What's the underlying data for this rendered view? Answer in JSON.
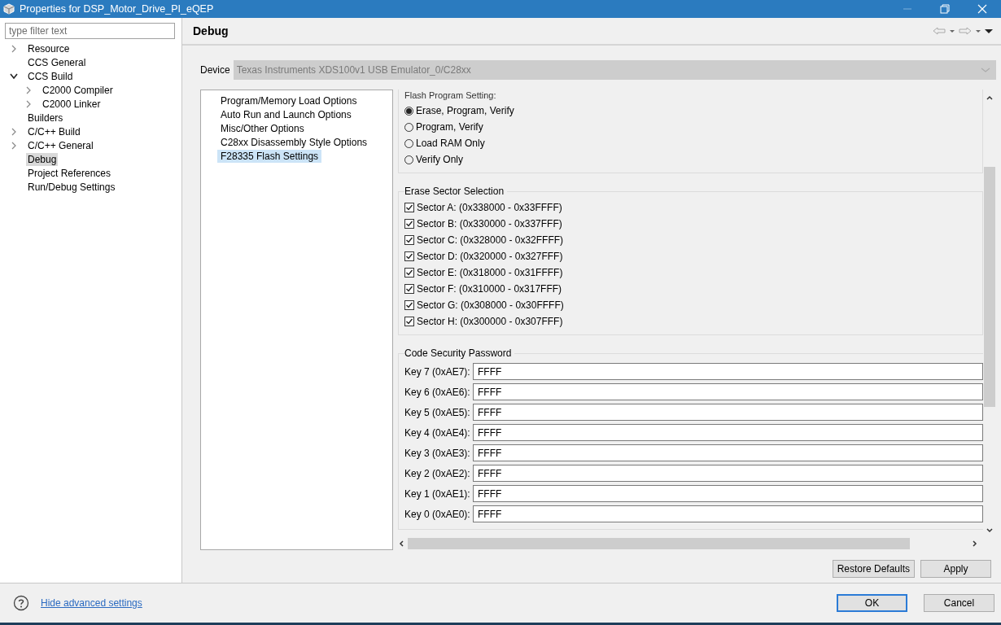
{
  "window": {
    "title": "Properties for DSP_Motor_Drive_PI_eQEP"
  },
  "filter": {
    "placeholder": "type filter text"
  },
  "tree": [
    {
      "label": "Resource",
      "expandable": true,
      "expanded": false,
      "selected": false
    },
    {
      "label": "CCS General",
      "expandable": false,
      "selected": false
    },
    {
      "label": "CCS Build",
      "expandable": true,
      "expanded": true,
      "selected": false,
      "children": [
        {
          "label": "C2000 Compiler",
          "expandable": true,
          "expanded": false,
          "selected": false
        },
        {
          "label": "C2000 Linker",
          "expandable": true,
          "expanded": false,
          "selected": false
        }
      ]
    },
    {
      "label": "Builders",
      "expandable": false,
      "selected": false
    },
    {
      "label": "C/C++ Build",
      "expandable": true,
      "expanded": false,
      "selected": false
    },
    {
      "label": "C/C++ General",
      "expandable": true,
      "expanded": false,
      "selected": false
    },
    {
      "label": "Debug",
      "expandable": false,
      "selected": true
    },
    {
      "label": "Project References",
      "expandable": false,
      "selected": false
    },
    {
      "label": "Run/Debug Settings",
      "expandable": false,
      "selected": false
    }
  ],
  "page": {
    "title": "Debug"
  },
  "device": {
    "label": "Device",
    "value": "Texas Instruments XDS100v1 USB Emulator_0/C28xx",
    "disabled": true
  },
  "categories": [
    {
      "label": "Program/Memory Load Options",
      "selected": false
    },
    {
      "label": "Auto Run and Launch Options",
      "selected": false
    },
    {
      "label": "Misc/Other Options",
      "selected": false
    },
    {
      "label": "C28xx Disassembly Style Options",
      "selected": false
    },
    {
      "label": "F28335 Flash Settings",
      "selected": true
    }
  ],
  "flash_program": {
    "title": "Flash Program Setting:",
    "options": [
      {
        "label": "Erase, Program, Verify",
        "selected": true
      },
      {
        "label": "Program, Verify",
        "selected": false
      },
      {
        "label": "Load RAM Only",
        "selected": false
      },
      {
        "label": "Verify Only",
        "selected": false
      }
    ]
  },
  "erase_sectors": {
    "title": "Erase Sector Selection",
    "items": [
      {
        "label": "Sector A: (0x338000 - 0x33FFFF)",
        "checked": true
      },
      {
        "label": "Sector B: (0x330000 - 0x337FFF)",
        "checked": true
      },
      {
        "label": "Sector C: (0x328000 - 0x32FFFF)",
        "checked": true
      },
      {
        "label": "Sector D: (0x320000 - 0x327FFF)",
        "checked": true
      },
      {
        "label": "Sector E: (0x318000 - 0x31FFFF)",
        "checked": true
      },
      {
        "label": "Sector F: (0x310000 - 0x317FFF)",
        "checked": true
      },
      {
        "label": "Sector G: (0x308000 - 0x30FFFF)",
        "checked": true
      },
      {
        "label": "Sector H: (0x300000 - 0x307FFF)",
        "checked": true
      }
    ]
  },
  "code_security": {
    "title": "Code Security Password",
    "keys": [
      {
        "label": "Key 7 (0xAE7):",
        "value": "FFFF"
      },
      {
        "label": "Key 6 (0xAE6):",
        "value": "FFFF"
      },
      {
        "label": "Key 5 (0xAE5):",
        "value": "FFFF"
      },
      {
        "label": "Key 4 (0xAE4):",
        "value": "FFFF"
      },
      {
        "label": "Key 3 (0xAE3):",
        "value": "FFFF"
      },
      {
        "label": "Key 2 (0xAE2):",
        "value": "FFFF"
      },
      {
        "label": "Key 1 (0xAE1):",
        "value": "FFFF"
      },
      {
        "label": "Key 0 (0xAE0):",
        "value": "FFFF"
      }
    ]
  },
  "page_buttons": [
    {
      "label": "Restore Defaults",
      "default": false
    },
    {
      "label": "Apply",
      "default": false
    }
  ],
  "footer": {
    "link": "Hide advanced settings",
    "buttons": [
      {
        "label": "OK",
        "default": true
      },
      {
        "label": "Cancel",
        "default": false
      }
    ]
  }
}
